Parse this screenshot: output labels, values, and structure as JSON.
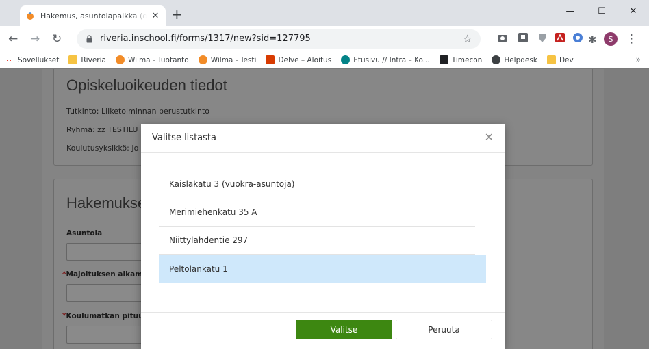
{
  "browser": {
    "tab": {
      "title": "Hakemus, asuntolapaikka (opiskelu)"
    },
    "url": "riveria.inschool.fi/forms/1317/new?sid=127795",
    "profile_initial": "S",
    "bookmarks": [
      {
        "label": "Sovellukset",
        "color": "#4285f4"
      },
      {
        "label": "Riveria",
        "color": "#f6c343"
      },
      {
        "label": "Wilma - Tuotanto",
        "color": "#f28c28"
      },
      {
        "label": "Wilma - Testi",
        "color": "#f28c28"
      },
      {
        "label": "Delve – Aloitus",
        "color": "#d83b01"
      },
      {
        "label": "Etusivu // Intra – Ko...",
        "color": "#038387"
      },
      {
        "label": "Timecon",
        "color": "#202124"
      },
      {
        "label": "Helpdesk",
        "color": "#3c4043"
      },
      {
        "label": "Dev",
        "color": "#f6c343"
      }
    ]
  },
  "page": {
    "section1": {
      "title": "Opiskeluoikeuden tiedot",
      "lines": [
        "Tutkinto: Liiketoiminnan perustutkinto",
        "Ryhmä: zz TESTILU",
        "Koulutusyksikkö: Jo"
      ]
    },
    "section2": {
      "title": "Hakemukse",
      "fields": [
        {
          "label": "Asuntola",
          "required": false
        },
        {
          "label": "Majoituksen alkamis",
          "required": true
        },
        {
          "label": "Koulumatkan pituus",
          "required": true
        }
      ]
    }
  },
  "modal": {
    "title": "Valitse listasta",
    "items": [
      "Kaislakatu 3 (vuokra-asuntoja)",
      "Merimiehenkatu 35 A",
      "Niittylahdentie 297",
      "Peltolankatu 1"
    ],
    "selected_index": 3,
    "primary_label": "Valitse",
    "secondary_label": "Peruuta"
  }
}
